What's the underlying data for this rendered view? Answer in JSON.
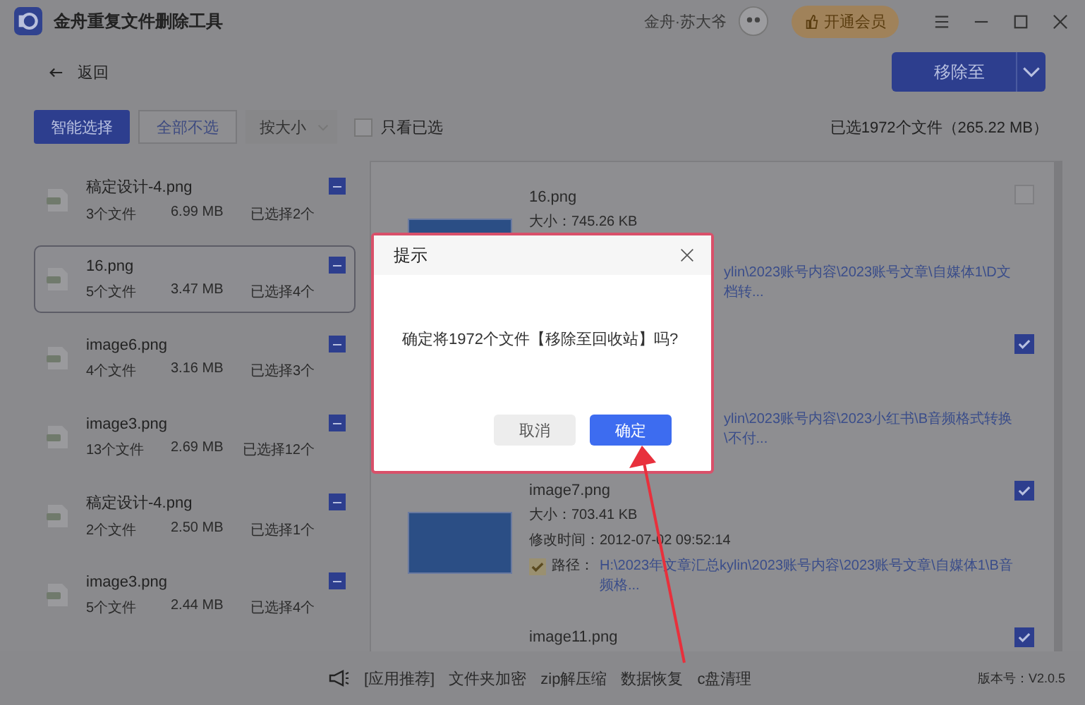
{
  "window": {
    "title": "金舟重复文件删除工具",
    "user": "金舟·苏大爷",
    "vip_button": "开通会员"
  },
  "toolbar": {
    "back": "返回",
    "move_button": "移除至"
  },
  "filter_bar": {
    "smart_select": "智能选择",
    "deselect_all": "全部不选",
    "sort": "按大小",
    "only_selected": {
      "label": "只看已选",
      "checked": false
    },
    "summary": "已选1972个文件（265.22 MB）"
  },
  "groups": [
    {
      "name": "稿定设计-4.png",
      "files": "3个文件",
      "size": "6.99 MB",
      "picked": "已选择2个",
      "partially_checked": true,
      "selected": false
    },
    {
      "name": "16.png",
      "files": "5个文件",
      "size": "3.47 MB",
      "picked": "已选择4个",
      "partially_checked": true,
      "selected": true
    },
    {
      "name": "image6.png",
      "files": "4个文件",
      "size": "3.16 MB",
      "picked": "已选择3个",
      "partially_checked": true,
      "selected": false
    },
    {
      "name": "image3.png",
      "files": "13个文件",
      "size": "2.69 MB",
      "picked": "已选择12个",
      "partially_checked": true,
      "selected": false
    },
    {
      "name": "稿定设计-4.png",
      "files": "2个文件",
      "size": "2.50 MB",
      "picked": "已选择1个",
      "partially_checked": true,
      "selected": false
    },
    {
      "name": "image3.png",
      "files": "5个文件",
      "size": "2.44 MB",
      "picked": "已选择4个",
      "partially_checked": true,
      "selected": false
    }
  ],
  "files": [
    {
      "checked": false,
      "lines": [
        {
          "kind": "name",
          "text": "16.png"
        },
        {
          "kind": "size",
          "text": "大小：745.26 KB"
        },
        {
          "kind": "path_fragment",
          "text": "ylin\\2023账号内容\\2023账号文章\\自媒体1\\D文档转..."
        }
      ]
    },
    {
      "checked": true,
      "lines": [
        {
          "kind": "path_fragment",
          "text": "ylin\\2023账号内容\\2023小红书\\B音频格式转换\\不付..."
        }
      ]
    },
    {
      "checked": true,
      "lines": [
        {
          "kind": "name",
          "text": "image7.png"
        },
        {
          "kind": "size",
          "text": "大小：703.41 KB"
        },
        {
          "kind": "time",
          "text": "修改时间：2012-07-02 09:52:14"
        },
        {
          "kind": "path",
          "label": "路径：",
          "text": "H:\\2023年文章汇总kylin\\2023账号内容\\2023账号文章\\自媒体1\\B音频格...",
          "checked": true
        }
      ]
    },
    {
      "checked": true,
      "lines": [
        {
          "kind": "name",
          "text": "image11.png"
        }
      ]
    }
  ],
  "dialog": {
    "title": "提示",
    "message": "确定将1972个文件【移除至回收站】吗?",
    "cancel": "取消",
    "confirm": "确定"
  },
  "footer": {
    "links": [
      "[应用推荐]",
      "文件夹加密",
      "zip解压缩",
      "数据恢复",
      "c盘清理"
    ],
    "version": "版本号：V2.0.5"
  }
}
